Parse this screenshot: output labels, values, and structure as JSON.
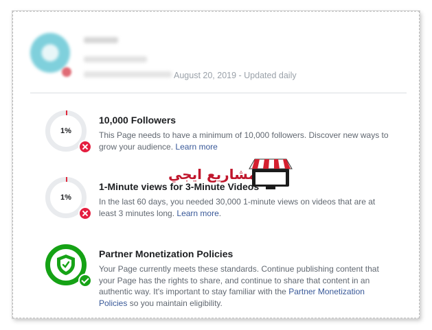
{
  "header": {
    "updated_text": "August 20, 2019 - Updated daily"
  },
  "requirements": [
    {
      "percent": "1%",
      "title": "10,000 Followers",
      "description": "This Page needs to have a minimum of 10,000 followers. Discover new ways to grow your audience.",
      "link_text": "Learn more",
      "status": "not-met"
    },
    {
      "percent": "1%",
      "title": "1-Minute views for 3-Minute Videos",
      "description": "In the last 60 days, you needed 30,000 1-minute views on videos that are at least 3 minutes long.",
      "link_text": "Learn more",
      "suffix": ".",
      "status": "not-met"
    },
    {
      "title": "Partner Monetization Policies",
      "description": "Your Page currently meets these standards. Continue publishing content that your Page has the rights to share, and continue to share that content in an authentic way. It's important to stay familiar with the",
      "link_text": "Partner Monetization Policies",
      "suffix": "so you maintain eligibility.",
      "status": "met"
    }
  ],
  "watermark": {
    "text": "مشاريع ايجي"
  },
  "colors": {
    "link": "#385898",
    "fail": "#e41e3f",
    "pass": "#17a317",
    "ring_track": "#e9ebee"
  }
}
